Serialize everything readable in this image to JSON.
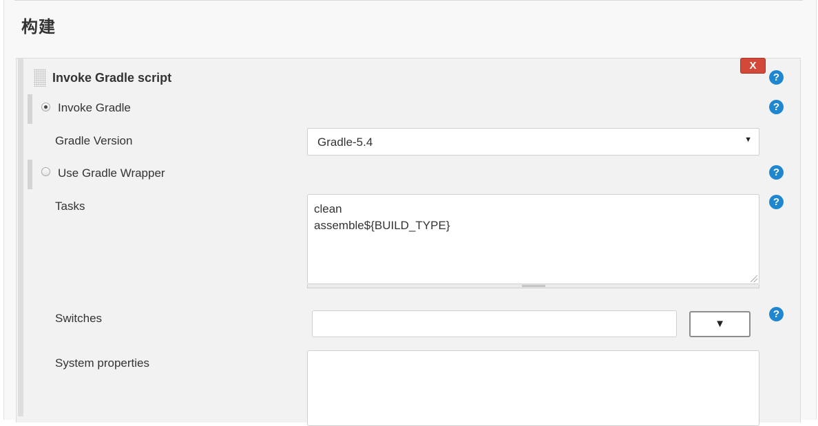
{
  "section": {
    "title": "构建"
  },
  "step": {
    "title": "Invoke Gradle script",
    "delete_label": "X"
  },
  "help_label": "?",
  "options": {
    "invoke_gradle": {
      "label": "Invoke Gradle",
      "selected": true
    },
    "gradle_version": {
      "label": "Gradle Version",
      "value": "Gradle-5.4",
      "arrow": "▼"
    },
    "use_wrapper": {
      "label": "Use Gradle Wrapper",
      "selected": false
    }
  },
  "tasks": {
    "label": "Tasks",
    "lines": [
      "clean",
      "assemble${BUILD_TYPE}"
    ]
  },
  "switches": {
    "label": "Switches",
    "value": "",
    "button_label": "▼"
  },
  "system_properties": {
    "label": "System properties",
    "value": ""
  },
  "icons": {
    "drag": "drag-handle-icon",
    "help": "help-icon",
    "dropdown": "chevron-down-icon"
  },
  "colors": {
    "help_blue": "#1f86d0",
    "delete_red": "#d24939"
  }
}
